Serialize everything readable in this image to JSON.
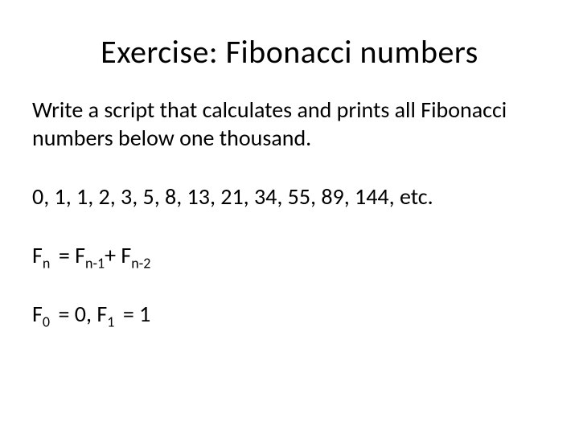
{
  "title": "Exercise: Fibonacci numbers",
  "intro": "Write a script that calculates and prints all Fibonacci numbers below one thousand.",
  "sequence": "0, 1, 1, 2, 3, 5, 8, 13, 21, 34, 55, 89, 144, etc.",
  "formula": {
    "F": "F",
    "n": "n",
    "eq": " = ",
    "n1": "n-1",
    "plus": "+ ",
    "n2": "n-2"
  },
  "base": {
    "F": "F",
    "zero_sub": "0",
    "zero_val": " = 0, ",
    "one_sub": "1",
    "one_val": " = 1"
  }
}
